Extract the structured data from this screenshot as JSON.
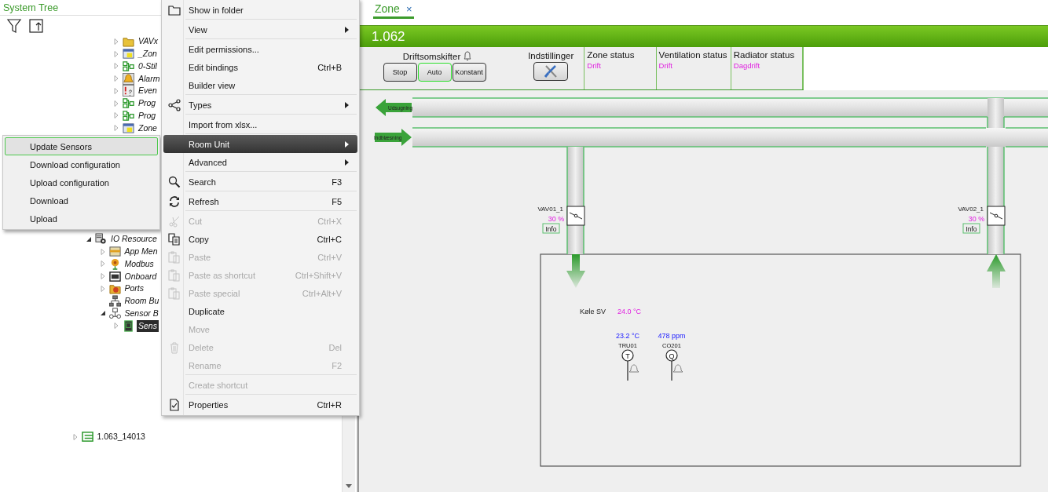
{
  "left_panel": {
    "title": "System Tree"
  },
  "tree": {
    "items": [
      {
        "children": [
          {
            "children": [
              {
                "children": [
                  {
                    "label": "VAVx",
                    "kind": "folder",
                    "expanded": false,
                    "selected": false,
                    "italic": true
                  },
                  {
                    "label": "_Zon",
                    "kind": "window",
                    "expanded": false,
                    "selected": false,
                    "italic": true
                  },
                  {
                    "label": "0-Stil",
                    "kind": "blocks",
                    "expanded": false,
                    "selected": false,
                    "italic": true
                  },
                  {
                    "label": "Alarm",
                    "kind": "bell",
                    "expanded": false,
                    "selected": false,
                    "italic": true
                  },
                  {
                    "label": "Even",
                    "kind": "event",
                    "expanded": false,
                    "selected": false,
                    "italic": true
                  },
                  {
                    "label": "Prog",
                    "kind": "blocks",
                    "expanded": false,
                    "selected": false,
                    "italic": true
                  },
                  {
                    "label": "Prog",
                    "kind": "blocks",
                    "expanded": false,
                    "selected": false,
                    "italic": true
                  },
                  {
                    "label": "Zone",
                    "kind": "window",
                    "expanded": false,
                    "selected": false,
                    "italic": true
                  }
                ]
              }
            ]
          },
          {
            "label": "IO Resource",
            "kind": "gear",
            "expanded": true,
            "selected": false,
            "italic": true,
            "children": [
              {
                "label": "App Men",
                "kind": "card",
                "expanded": false,
                "selected": false,
                "italic": true
              },
              {
                "label": "Modbus",
                "kind": "flower",
                "expanded": false,
                "selected": false,
                "italic": true
              },
              {
                "label": "Onboard",
                "kind": "io",
                "expanded": false,
                "selected": false,
                "italic": true
              },
              {
                "label": "Ports",
                "kind": "ports",
                "expanded": false,
                "selected": false,
                "italic": true
              },
              {
                "label": "Room Bu",
                "kind": "network",
                "selected": false,
                "italic": true
              },
              {
                "label": "Sensor B",
                "kind": "bus",
                "expanded": true,
                "selected": false,
                "italic": true,
                "children": [
                  {
                    "label": "Sens",
                    "kind": "sensor",
                    "expanded": false,
                    "selected": true,
                    "italic": true
                  }
                ]
              }
            ]
          }
        ]
      },
      {
        "label": "1.063_14013",
        "kind": "device",
        "expanded": false,
        "selected": false,
        "italic": false
      }
    ]
  },
  "submenu": {
    "items": [
      {
        "label": "Update Sensors",
        "selected": true
      },
      {
        "label": "Download configuration",
        "selected": false
      },
      {
        "label": "Upload configuration",
        "selected": false
      },
      {
        "label": "Download",
        "selected": false
      },
      {
        "label": "Upload",
        "selected": false
      }
    ]
  },
  "context_menu": {
    "items": [
      {
        "kind": "folder",
        "label": "Show in folder",
        "disabled": false,
        "submenu": false,
        "selected": false
      },
      {
        "kind": "separator"
      },
      {
        "kind": "plain",
        "label": "View",
        "disabled": false,
        "submenu": true,
        "selected": false
      },
      {
        "kind": "separator"
      },
      {
        "kind": "plain",
        "label": "Edit permissions...",
        "disabled": false,
        "submenu": false,
        "selected": false
      },
      {
        "kind": "plain",
        "label": "Edit bindings",
        "shortcut": "Ctrl+B",
        "disabled": false,
        "submenu": false,
        "selected": false
      },
      {
        "kind": "plain",
        "label": "Builder view",
        "disabled": false,
        "submenu": false,
        "selected": false
      },
      {
        "kind": "separator"
      },
      {
        "kind": "share",
        "label": "Types",
        "disabled": false,
        "submenu": true,
        "selected": false
      },
      {
        "kind": "separator"
      },
      {
        "kind": "plain",
        "label": "Import from xlsx...",
        "disabled": false,
        "submenu": false,
        "selected": false
      },
      {
        "kind": "separator"
      },
      {
        "kind": "plain",
        "label": "Room Unit",
        "disabled": false,
        "submenu": true,
        "selected": true
      },
      {
        "kind": "plain",
        "label": "Advanced",
        "disabled": false,
        "submenu": true,
        "selected": false
      },
      {
        "kind": "separator"
      },
      {
        "kind": "search",
        "label": "Search",
        "shortcut": "F3",
        "disabled": false,
        "submenu": false,
        "selected": false
      },
      {
        "kind": "separator"
      },
      {
        "kind": "refresh",
        "label": "Refresh",
        "shortcut": "F5",
        "disabled": false,
        "submenu": false,
        "selected": false
      },
      {
        "kind": "separator"
      },
      {
        "kind": "scissors",
        "label": "Cut",
        "shortcut": "Ctrl+X",
        "disabled": true,
        "submenu": false,
        "selected": false
      },
      {
        "kind": "copy",
        "label": "Copy",
        "shortcut": "Ctrl+C",
        "disabled": false,
        "submenu": false,
        "selected": false
      },
      {
        "kind": "paste",
        "label": "Paste",
        "shortcut": "Ctrl+V",
        "disabled": true,
        "submenu": false,
        "selected": false
      },
      {
        "kind": "paste",
        "label": "Paste as shortcut",
        "shortcut": "Ctrl+Shift+V",
        "disabled": true,
        "submenu": false,
        "selected": false
      },
      {
        "kind": "paste",
        "label": "Paste special",
        "shortcut": "Ctrl+Alt+V",
        "disabled": true,
        "submenu": false,
        "selected": false
      },
      {
        "kind": "plain",
        "label": "Duplicate",
        "disabled": false,
        "submenu": false,
        "selected": false
      },
      {
        "kind": "plain",
        "label": "Move",
        "disabled": true,
        "submenu": false,
        "selected": false
      },
      {
        "kind": "trash",
        "label": "Delete",
        "shortcut": "Del",
        "disabled": true,
        "submenu": false,
        "selected": false
      },
      {
        "kind": "plain",
        "label": "Rename",
        "shortcut": "F2",
        "disabled": true,
        "submenu": false,
        "selected": false
      },
      {
        "kind": "separator"
      },
      {
        "kind": "plain",
        "label": "Create shortcut",
        "disabled": true,
        "submenu": false,
        "selected": false
      },
      {
        "kind": "separator"
      },
      {
        "kind": "document",
        "label": "Properties",
        "shortcut": "Ctrl+R",
        "disabled": false,
        "submenu": false,
        "selected": false
      }
    ]
  },
  "tabs": [
    {
      "label": "Zone",
      "selected": true,
      "close": "×"
    }
  ],
  "zone": {
    "title": "1.062"
  },
  "controls": {
    "mode": {
      "title": "Driftsomskifter",
      "buttons": [
        {
          "label": "Stop",
          "selected": false
        },
        {
          "label": "Auto",
          "selected": true
        },
        {
          "label": "Konstant",
          "selected": false
        }
      ]
    },
    "settings": {
      "title": "Indstillinger"
    },
    "statuses": [
      {
        "title": "Zone status",
        "value": "Drift"
      },
      {
        "title": "Ventilation status",
        "value": "Drift"
      },
      {
        "title": "Radiator status",
        "value": "Dagdrift"
      }
    ]
  },
  "diagram": {
    "ducts": [
      {
        "label": "Udsugning"
      },
      {
        "label": "Indblæsning"
      }
    ],
    "vavs": [
      {
        "name": "VAV01_1",
        "reading": "30 %",
        "button": "Info"
      },
      {
        "name": "VAV02_1",
        "reading": "30 %",
        "button": "Info"
      }
    ],
    "setpoint": {
      "label": "Køle SV",
      "value": "24.0 °C"
    },
    "sensors": [
      {
        "value": "23.2 °C",
        "name": "TRU01",
        "symbol": "T"
      },
      {
        "value": "478 ppm",
        "name": "CO201",
        "symbol": "Q"
      }
    ]
  }
}
